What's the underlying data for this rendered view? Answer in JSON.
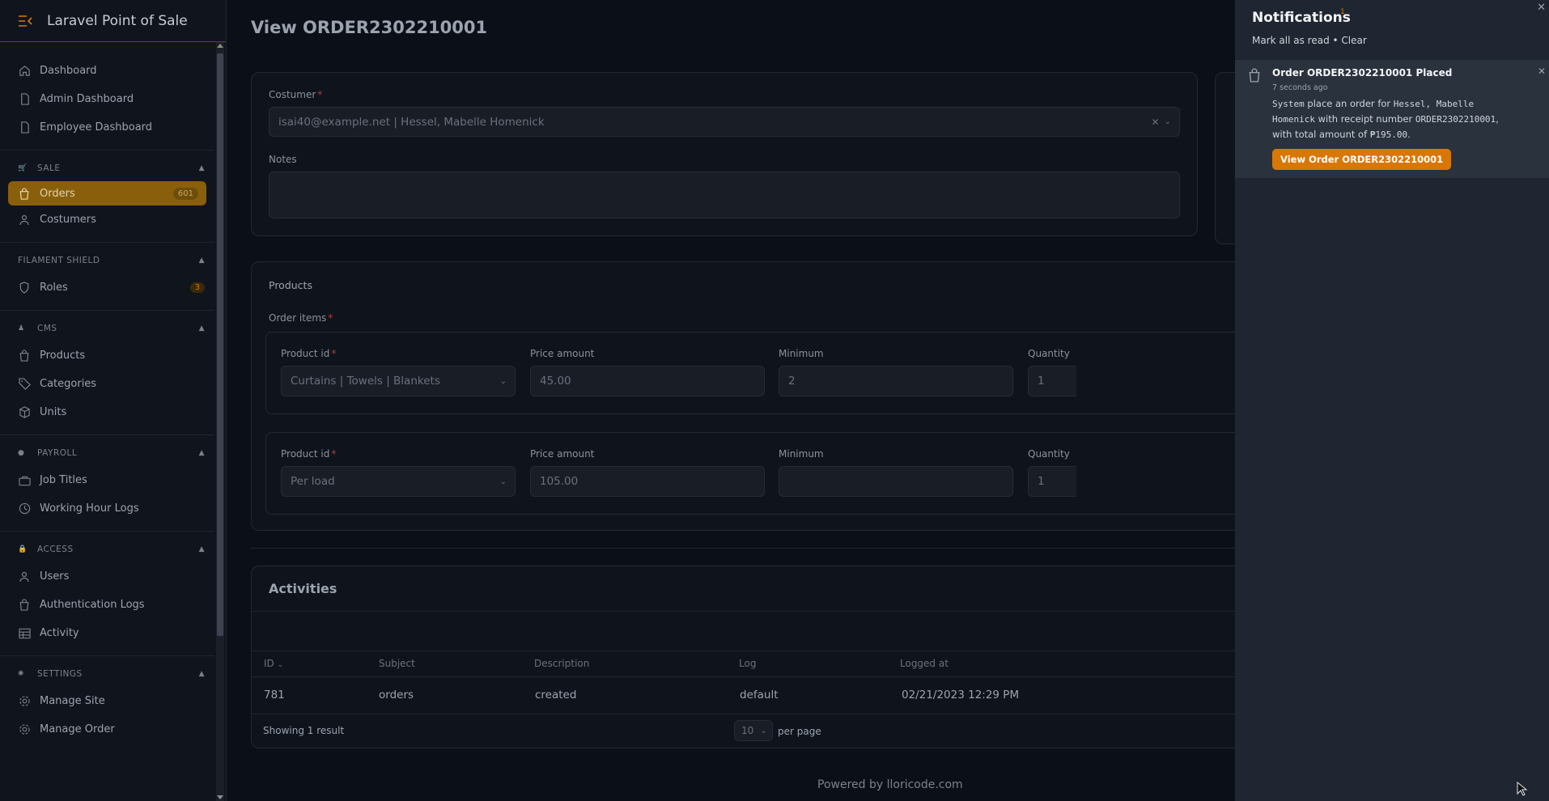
{
  "app": {
    "title": "Laravel Point of Sale"
  },
  "sidebar": {
    "top_items": [
      {
        "label": "Dashboard",
        "icon": "home-icon"
      },
      {
        "label": "Admin Dashboard",
        "icon": "document-icon"
      },
      {
        "label": "Employee Dashboard",
        "icon": "document-icon"
      }
    ],
    "groups": {
      "sale": {
        "label": "SALE",
        "items": [
          {
            "label": "Orders",
            "badge": "601",
            "active": true
          },
          {
            "label": "Costumers"
          }
        ]
      },
      "shield": {
        "label": "FILAMENT SHIELD",
        "items": [
          {
            "label": "Roles",
            "badge": "3"
          }
        ]
      },
      "cms": {
        "label": "CMS",
        "items": [
          {
            "label": "Products"
          },
          {
            "label": "Categories"
          },
          {
            "label": "Units"
          }
        ]
      },
      "payroll": {
        "label": "PAYROLL",
        "items": [
          {
            "label": "Job Titles"
          },
          {
            "label": "Working Hour Logs"
          }
        ]
      },
      "access": {
        "label": "ACCESS",
        "items": [
          {
            "label": "Users"
          },
          {
            "label": "Authentication Logs"
          },
          {
            "label": "Activity"
          }
        ]
      },
      "settings": {
        "label": "SETTINGS",
        "items": [
          {
            "label": "Manage Site"
          },
          {
            "label": "Manage Order"
          }
        ]
      }
    }
  },
  "page": {
    "title": "View ORDER2302210001"
  },
  "form": {
    "customer_label": "Costumer",
    "customer_value": "isai40@example.net | Hessel, Mabelle Homenick",
    "notes_label": "Notes",
    "notes_value": ""
  },
  "products": {
    "section_label": "Products",
    "items_label": "Order items",
    "rows": [
      {
        "product_label": "Product id",
        "product_value": "Curtains | Towels | Blankets",
        "price_label": "Price amount",
        "price_value": "45.00",
        "min_label": "Minimum",
        "min_value": "2",
        "qty_label": "Quantity",
        "qty_value": "1"
      },
      {
        "product_label": "Product id",
        "product_value": "Per load",
        "price_label": "Price amount",
        "price_value": "105.00",
        "min_label": "Minimum",
        "min_value": "",
        "qty_label": "Quantity",
        "qty_value": "1"
      }
    ]
  },
  "activities": {
    "title": "Activities",
    "columns": [
      "ID",
      "Subject",
      "Description",
      "Log",
      "Logged at"
    ],
    "rows": [
      {
        "id": "781",
        "subject": "orders",
        "description": "created",
        "log": "default",
        "logged_at": "02/21/2023 12:29 PM"
      }
    ],
    "showing": "Showing 1 result",
    "per_page_value": "10",
    "per_page_label": "per page"
  },
  "footer": {
    "text": "Powered by lloricode.com"
  },
  "notifications": {
    "title": "Notifications",
    "count": "1",
    "mark_all": "Mark all as read",
    "separator": "•",
    "clear": "Clear",
    "item": {
      "title": "Order ORDER2302210001 Placed",
      "time": "7 seconds ago",
      "body_1": "System",
      "body_2": " place an order for ",
      "body_3": "Hessel, Mabelle Homenick",
      "body_4": " with receipt number ",
      "body_5": "ORDER2302210001",
      "body_6": ", with total amount of ",
      "body_7": "₱195.00",
      "body_8": ".",
      "button": "View Order ORDER2302210001"
    }
  },
  "colors": {
    "accent": "#d97706",
    "panel": "#1f2631",
    "background": "#0b0f17"
  }
}
